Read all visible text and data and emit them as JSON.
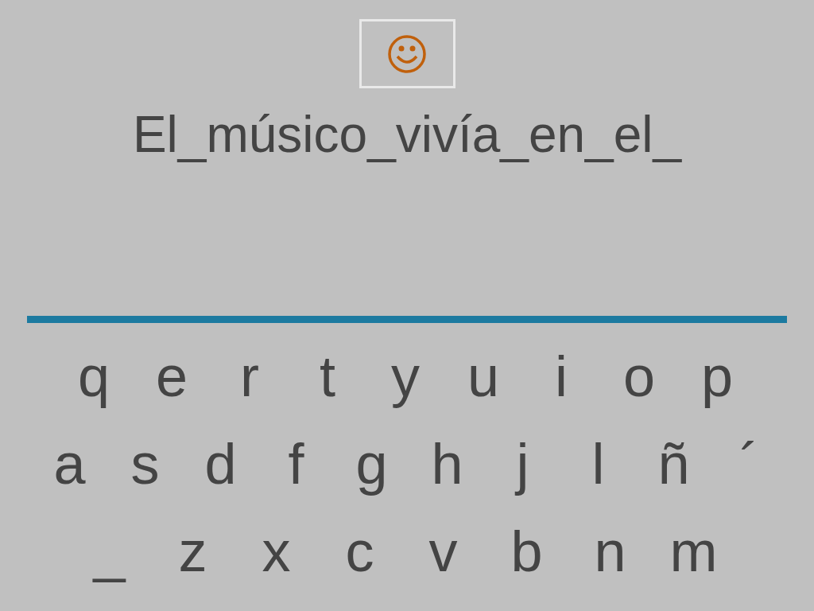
{
  "sentence": "El_músico_vivía_en_el_",
  "keyboard": {
    "rows": [
      [
        "q",
        "e",
        "r",
        "t",
        "y",
        "u",
        "i",
        "o",
        "p"
      ],
      [
        "a",
        "s",
        "d",
        "f",
        "g",
        "h",
        "j",
        "l",
        "ñ",
        "´"
      ],
      [
        "_",
        "z",
        "x",
        "c",
        "v",
        "b",
        "n",
        "m"
      ]
    ]
  }
}
